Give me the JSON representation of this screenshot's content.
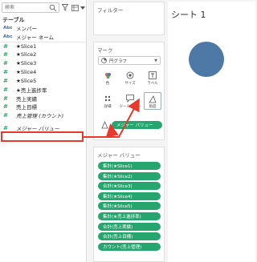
{
  "data_pane": {
    "search_placeholder": "検索",
    "section_title": "テーブル",
    "fields": [
      {
        "icon": "Abc",
        "type": "abc",
        "label": "メンバー"
      },
      {
        "icon": "Abc",
        "type": "abc",
        "label": "メジャー ネーム"
      },
      {
        "icon": "#",
        "type": "num",
        "label": "★Slice1"
      },
      {
        "icon": "#",
        "type": "num",
        "label": "★Slice2"
      },
      {
        "icon": "#",
        "type": "num",
        "label": "★Slice3"
      },
      {
        "icon": "#",
        "type": "num",
        "label": "★Slice4"
      },
      {
        "icon": "#",
        "type": "num",
        "label": "★Slice5"
      },
      {
        "icon": "#",
        "type": "num",
        "label": "★売上進捗率"
      },
      {
        "icon": "#",
        "type": "num",
        "label": "売上実績"
      },
      {
        "icon": "#",
        "type": "num",
        "label": "売上目標"
      },
      {
        "icon": "#",
        "type": "num",
        "label": "売上管理 (カウント)"
      },
      {
        "icon": "#",
        "type": "num",
        "label": "メジャー バリュー"
      }
    ]
  },
  "filters": {
    "title": "フィルター"
  },
  "marks": {
    "title": "マーク",
    "mark_type": "円グラフ",
    "buttons": {
      "color": "色",
      "size": "サイズ",
      "label": "ラベル",
      "detail": "詳細",
      "tooltip": "ツールヒント",
      "angle": "角度"
    },
    "pill": "メジャー バリュー"
  },
  "measures": {
    "title": "メジャー バリュー",
    "pills": [
      "集計(★Slice1)",
      "集計(★Slice2)",
      "合計(★Slice3)",
      "集計(★Slice4)",
      "集計(★Slice5)",
      "集計(★売上進捗率)",
      "合計(売上実績)",
      "合計(売上目標)",
      "カウント(売上管理)"
    ]
  },
  "sheet": {
    "title": "シート 1"
  },
  "colors": {
    "pill_green": "#27a56f",
    "pie_blue": "#4e79a7",
    "highlight_red": "#e8392c"
  }
}
